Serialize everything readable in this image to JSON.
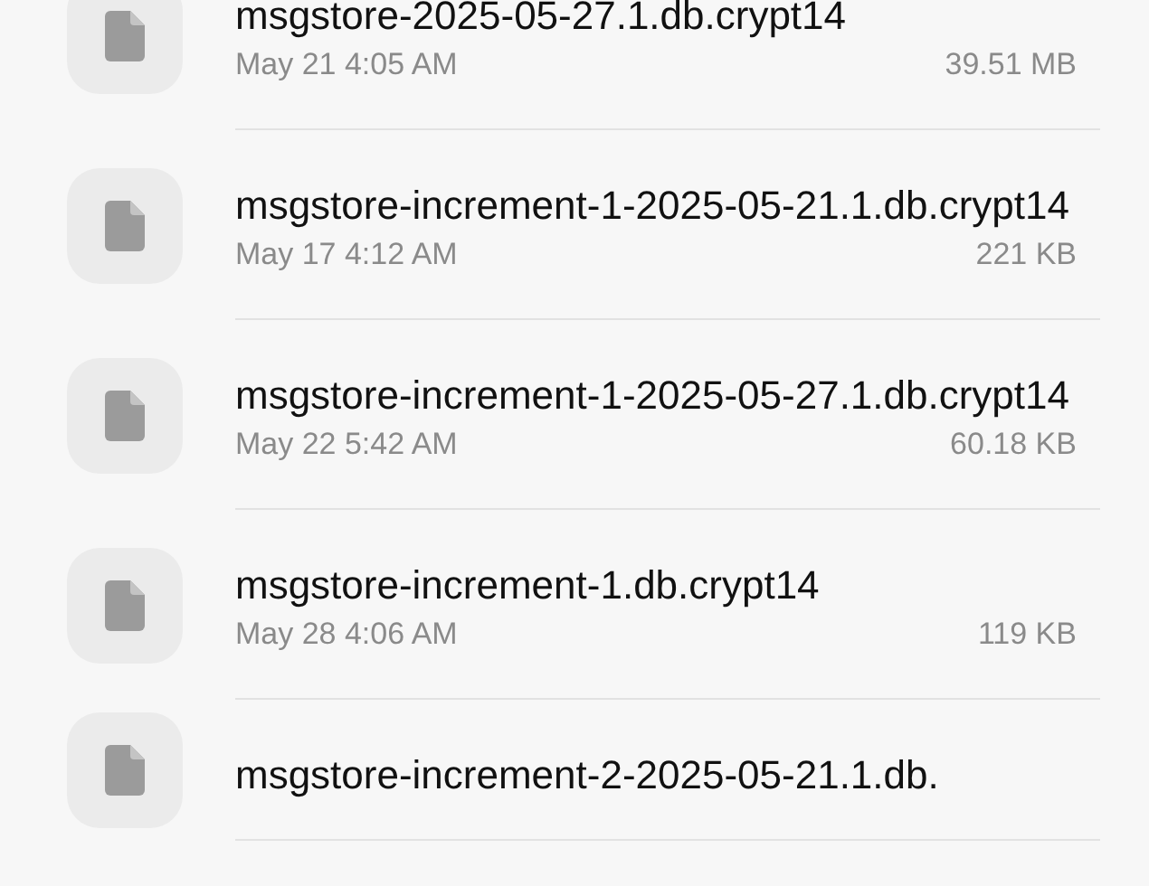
{
  "files": [
    {
      "name": "msgstore-2025-05-27.1.db.crypt14",
      "date": "May 21 4:05 AM",
      "size": "39.51 MB"
    },
    {
      "name": "msgstore-increment-1-2025-05-21.1.db.crypt14",
      "date": "May 17 4:12 AM",
      "size": "221 KB"
    },
    {
      "name": "msgstore-increment-1-2025-05-27.1.db.crypt14",
      "date": "May 22 5:42 AM",
      "size": "60.18 KB"
    },
    {
      "name": "msgstore-increment-1.db.crypt14",
      "date": "May 28 4:06 AM",
      "size": "119 KB"
    },
    {
      "name": "msgstore-increment-2-2025-05-21.1.db."
    }
  ]
}
